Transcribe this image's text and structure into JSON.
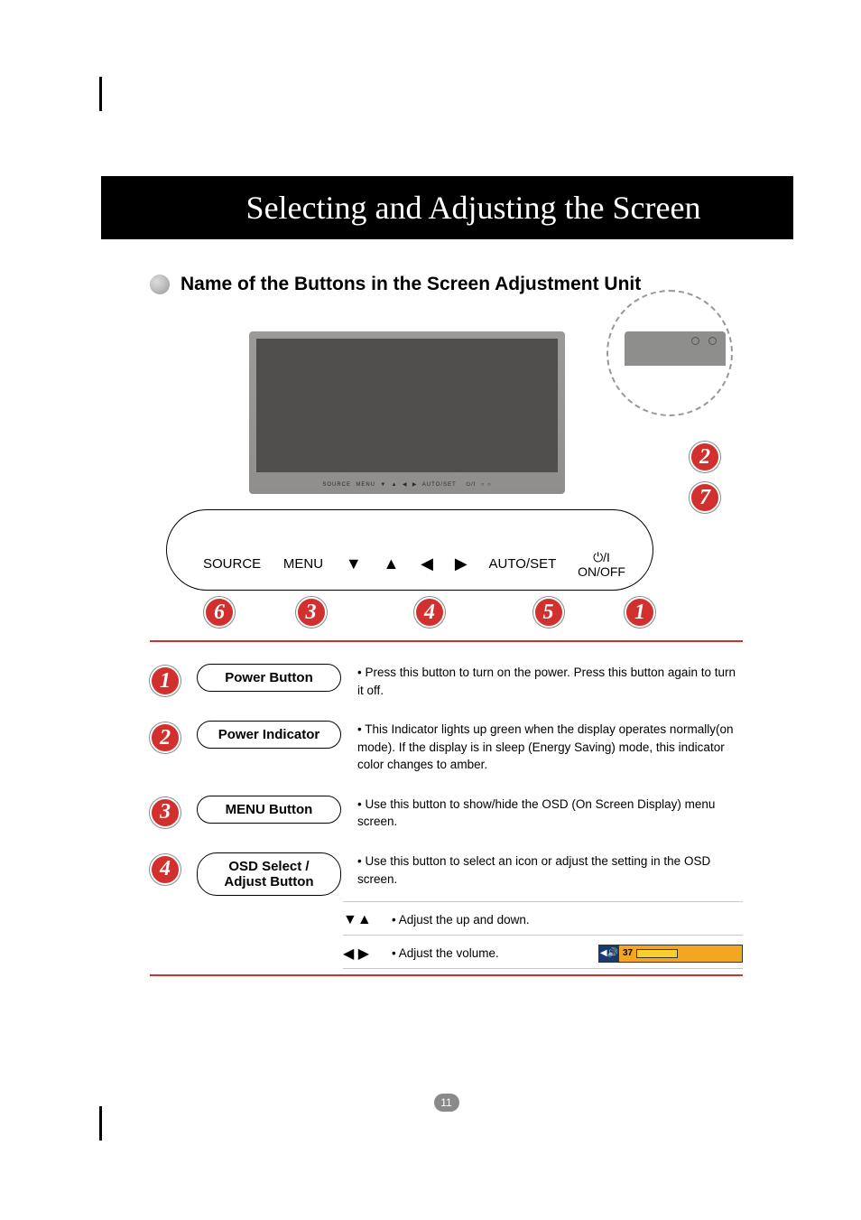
{
  "header": {
    "title": "Selecting and Adjusting the Screen"
  },
  "section": {
    "title": "Name of the Buttons in the Screen Adjustment Unit"
  },
  "diagram": {
    "buttons": {
      "source": "SOURCE",
      "menu": "MENU",
      "autoset": "AUTO/SET",
      "onoff_top": "⏻/I",
      "onoff_bottom": "ON/OFF"
    },
    "numbers": {
      "n1": "1",
      "n2": "2",
      "n3": "3",
      "n4": "4",
      "n5": "5",
      "n6": "6",
      "n7": "7"
    }
  },
  "items": [
    {
      "num": "1",
      "label": "Power Button",
      "desc": "Press this button to turn on the power. Press this button again to turn it off."
    },
    {
      "num": "2",
      "label": "Power Indicator",
      "desc": "This Indicator lights up green when the display operates normally(on mode). If the display is in sleep (Energy Saving) mode, this indicator color changes to amber."
    },
    {
      "num": "3",
      "label": "MENU Button",
      "desc": "Use this button to show/hide the OSD (On Screen Display) menu screen."
    },
    {
      "num": "4",
      "label_line1": "OSD Select /",
      "label_line2": "Adjust Button",
      "desc": "Use this button to select an icon or adjust the setting in the OSD screen.",
      "sub1": "Adjust the up and down.",
      "sub2": "Adjust the volume.",
      "volume": "37"
    }
  ],
  "footer": {
    "page": "11"
  }
}
